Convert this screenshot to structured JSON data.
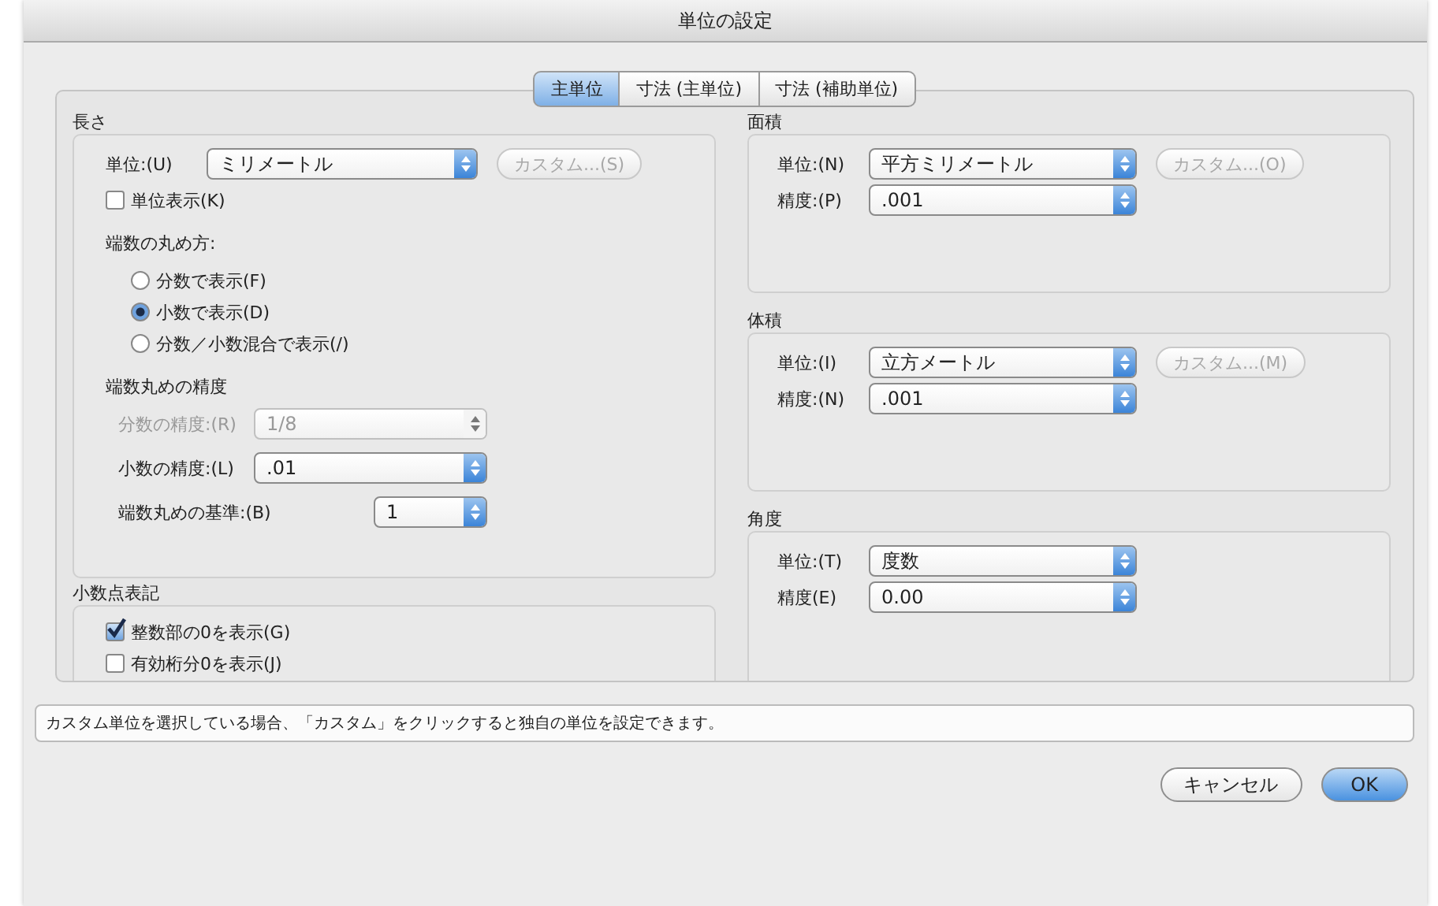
{
  "window": {
    "title": "単位の設定"
  },
  "tabs": [
    {
      "label": "主単位",
      "selected": true
    },
    {
      "label": "寸法 (主単位)",
      "selected": false
    },
    {
      "label": "寸法 (補助単位)",
      "selected": false
    }
  ],
  "length": {
    "title": "長さ",
    "unit": {
      "label": "単位:(U)",
      "value": "ミリメートル"
    },
    "custom_button": {
      "label": "カスタム...(S)",
      "disabled": true
    },
    "show_unit": {
      "label": "単位表示(K)",
      "checked": false
    },
    "rounding_title": "端数の丸め方:",
    "rounding_options": [
      {
        "label": "分数で表示(F)",
        "selected": false
      },
      {
        "label": "小数で表示(D)",
        "selected": true
      },
      {
        "label": "分数／小数混合で表示(/)",
        "selected": false
      }
    ],
    "precision_title": "端数丸めの精度",
    "precision_rows": [
      {
        "label": "分数の精度:(R)",
        "value": "1/8",
        "disabled": true,
        "kind": "wide"
      },
      {
        "label": "小数の精度:(L)",
        "value": ".01",
        "disabled": false,
        "kind": "wide"
      },
      {
        "label": "端数丸めの基準:(B)",
        "value": "1",
        "disabled": false,
        "kind": "short"
      }
    ]
  },
  "decimal": {
    "title": "小数点表記",
    "options": [
      {
        "label": "整数部の0を表示(G)",
        "checked": true
      },
      {
        "label": "有効桁分0を表示(J)",
        "checked": false
      }
    ]
  },
  "sections": [
    {
      "title": "面積",
      "rows": [
        {
          "label": "単位:(N)",
          "value": "平方ミリメートル"
        },
        {
          "label": "精度:(P)",
          "value": ".001"
        }
      ],
      "custom_button": {
        "label": "カスタム...(O)",
        "disabled": true
      }
    },
    {
      "title": "体積",
      "rows": [
        {
          "label": "単位:(I)",
          "value": "立方メートル"
        },
        {
          "label": "精度:(N)",
          "value": ".001"
        }
      ],
      "custom_button": {
        "label": "カスタム...(M)",
        "disabled": true
      }
    },
    {
      "title": "角度",
      "rows": [
        {
          "label": "単位:(T)",
          "value": "度数"
        },
        {
          "label": "精度(E)",
          "value": "0.00"
        }
      ]
    }
  ],
  "hint": {
    "value": "カスタム単位を選択している場合、「カスタム」をクリックすると独自の単位を設定できます。"
  },
  "buttons": [
    {
      "label": "キャンセル",
      "default": false
    },
    {
      "label": "OK",
      "default": true
    }
  ]
}
